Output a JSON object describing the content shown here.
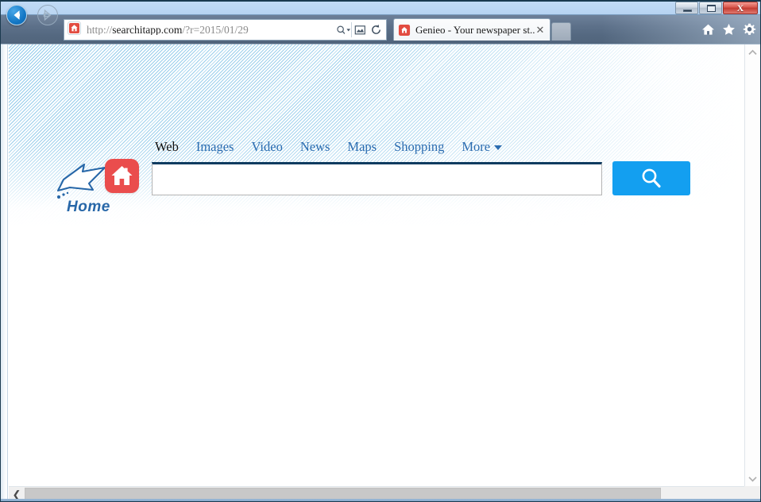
{
  "window": {
    "controls": {
      "minimize_label": "Minimize",
      "maximize_label": "Maximize",
      "close_label": "X"
    }
  },
  "browser": {
    "back_label": "Back",
    "forward_label": "Forward",
    "address": {
      "scheme": "http://",
      "host": "searchitapp.com",
      "path": "/?r=2015/01/29",
      "full": "http://searchitapp.com/?r=2015/01/29",
      "favicon": "red-house-icon",
      "search_icon": "search-dropdown-icon",
      "compat_icon": "compatibility-view-icon",
      "refresh_icon": "refresh-icon"
    },
    "tabs": [
      {
        "title": "Genieo - Your newspaper st...",
        "favicon": "red-house-icon",
        "close_label": "✕",
        "active": true
      }
    ],
    "new_tab_label": "",
    "command_icons": [
      {
        "name": "home-icon",
        "label": "Home"
      },
      {
        "name": "favorites-star-icon",
        "label": "Favorites"
      },
      {
        "name": "tools-gear-icon",
        "label": "Tools"
      }
    ]
  },
  "page": {
    "logo": {
      "label": "Home",
      "house_icon": "red-house-icon",
      "cursor_icon": "arrow-cursor-icon",
      "house_color": "#ea4d4d",
      "label_color": "#2767a8"
    },
    "nav": [
      {
        "label": "Web",
        "active": true
      },
      {
        "label": "Images",
        "active": false
      },
      {
        "label": "Video",
        "active": false
      },
      {
        "label": "News",
        "active": false
      },
      {
        "label": "Maps",
        "active": false
      },
      {
        "label": "Shopping",
        "active": false
      },
      {
        "label": "More",
        "active": false,
        "caret": true
      }
    ],
    "search": {
      "value": "",
      "placeholder": "",
      "button_icon": "search-magnifier-icon",
      "button_color": "#139ff0",
      "input_top_border_color": "#103c60"
    },
    "background_color": "#2998d6"
  },
  "scrollbars": {
    "vertical": {
      "up_label": "∧",
      "down_label": "∨"
    },
    "horizontal": {
      "left_label": "❮",
      "right_label": "❯"
    }
  }
}
